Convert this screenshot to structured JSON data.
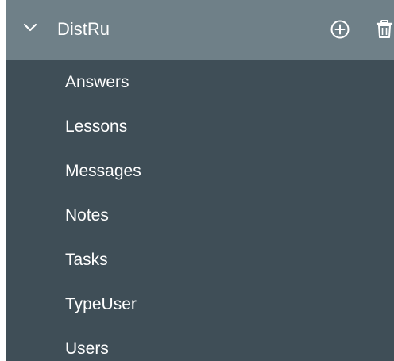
{
  "tree": {
    "header": {
      "title": "DistRu",
      "expand_icon": "chevron-down-icon",
      "add_icon": "plus-circle-icon",
      "delete_icon": "trash-icon"
    },
    "items": [
      {
        "label": "Answers"
      },
      {
        "label": "Lessons"
      },
      {
        "label": "Messages"
      },
      {
        "label": "Notes"
      },
      {
        "label": "Tasks"
      },
      {
        "label": "TypeUser"
      },
      {
        "label": "Users"
      }
    ]
  },
  "colors": {
    "header_bg": "#6f8088",
    "panel_bg": "#3f4e57",
    "text": "#ffffff"
  }
}
